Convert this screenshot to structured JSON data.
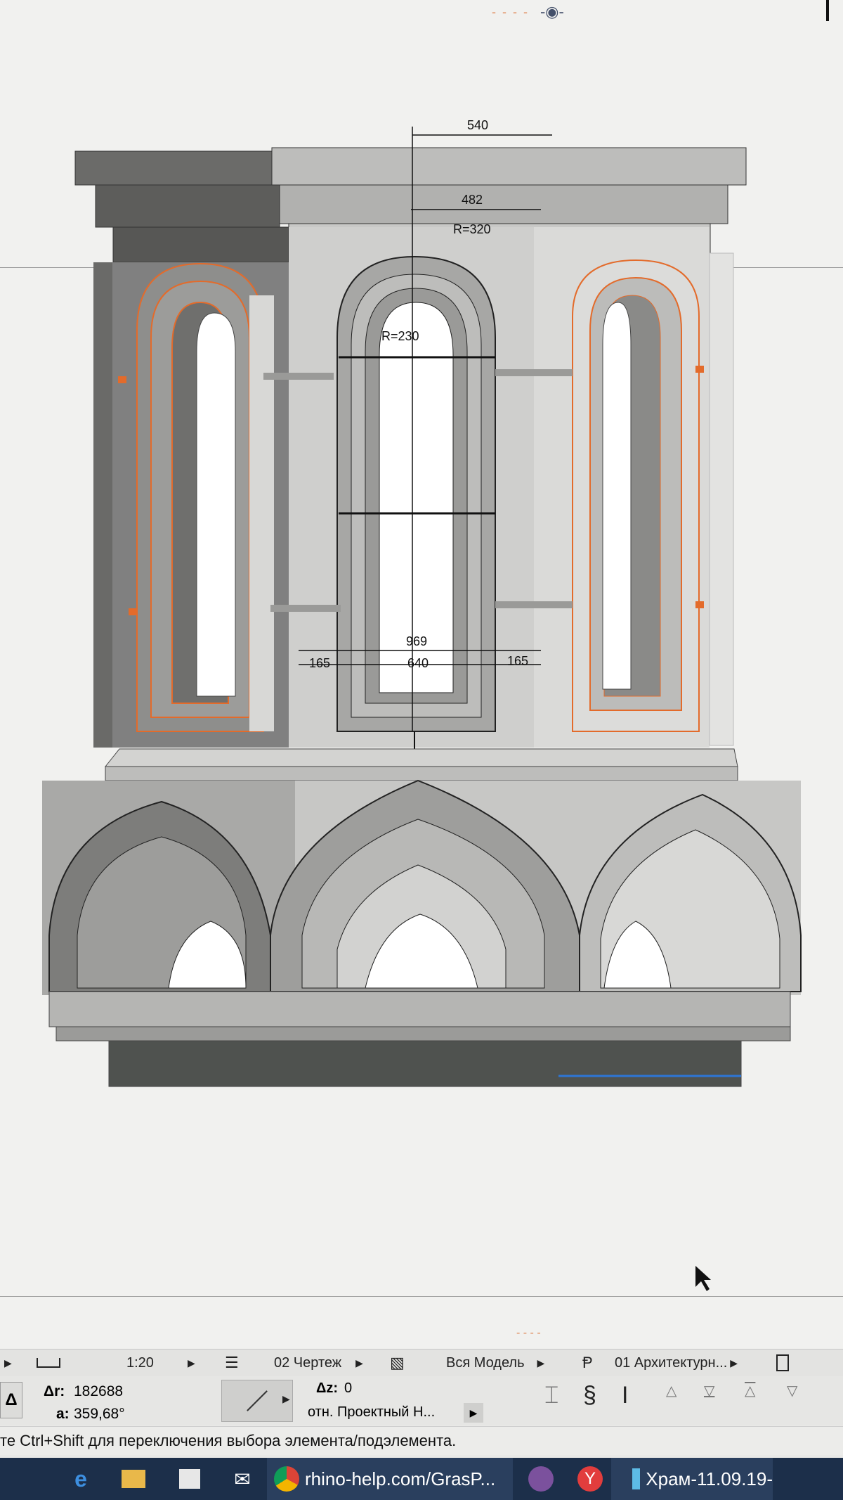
{
  "drawing": {
    "dimensions": {
      "top_width": "540",
      "inner_width": "482",
      "outer_radius": "R=320",
      "inner_radius": "R=230",
      "total_width": "969",
      "center_width": "640",
      "left_side": "165",
      "right_side": "165"
    }
  },
  "toolbar": {
    "scale_value": "1:20",
    "layer_value": "02 Чертеж",
    "model_value": "Вся Модель",
    "arch_value": "01 Архитектурн..."
  },
  "coords": {
    "dr_label": "Δr:",
    "dr_value": "182688",
    "a_label": "a:",
    "a_value": "359,68°",
    "dz_label": "Δz:",
    "dz_value": "0",
    "ref_label": "отн. Проектный Н..."
  },
  "status": {
    "hint": "те Ctrl+Shift для переключения выбора элемента/подэлемента."
  },
  "taskbar": {
    "browser_title": "rhino-help.com/GrasP...",
    "app_title": "Храм-11.09.19-"
  },
  "colors": {
    "accent": "#e36b2b",
    "taskbar": "#1c2f4a"
  }
}
